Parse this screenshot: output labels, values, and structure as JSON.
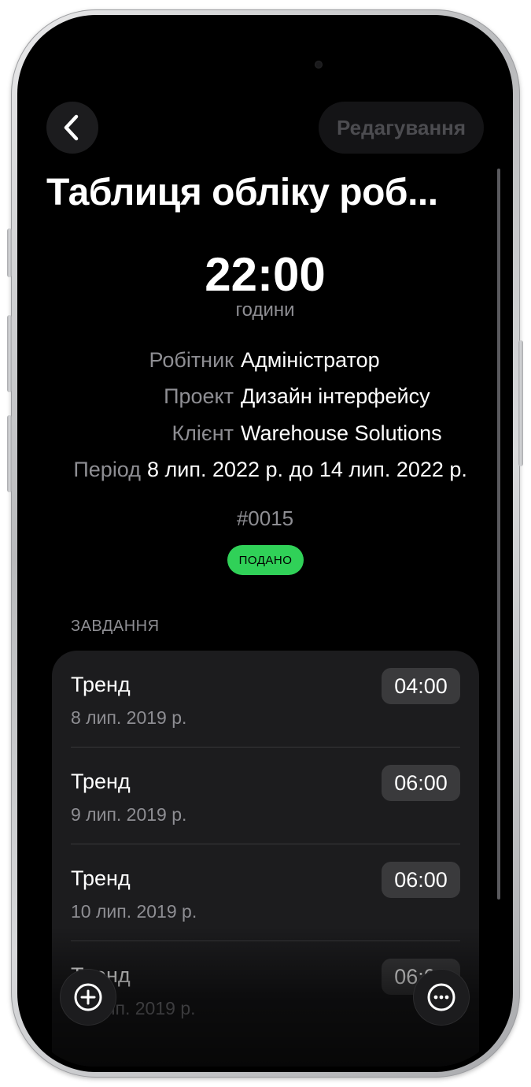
{
  "nav": {
    "back_icon": "chevron-left-icon",
    "edit_label": "Редагування"
  },
  "title": "Таблиця обліку роб...",
  "total": {
    "hours_value": "22:00",
    "hours_label": "години"
  },
  "info": {
    "worker_label": "Робітник",
    "worker_value": "Адміністратор",
    "project_label": "Проект",
    "project_value": "Дизайн інтерфейсу",
    "client_label": "Клієнт",
    "client_value": "Warehouse Solutions",
    "period_label": "Період",
    "period_value": "8 лип. 2022 р. до 14 лип. 2022 р."
  },
  "number": "#0015",
  "status": {
    "label": "ПОДАНО",
    "color": "#30d158"
  },
  "tasks_header": "ЗАВДАННЯ",
  "tasks": [
    {
      "name": "Тренд",
      "date": "8 лип. 2019 р.",
      "hours": "04:00"
    },
    {
      "name": "Тренд",
      "date": "9 лип. 2019 р.",
      "hours": "06:00"
    },
    {
      "name": "Тренд",
      "date": "10 лип. 2019 р.",
      "hours": "06:00"
    },
    {
      "name": "Тренд",
      "date": "11 лип. 2019 р.",
      "hours": "06:00"
    }
  ],
  "fab": {
    "add_icon": "plus-circle-icon",
    "more_icon": "ellipsis-circle-icon"
  }
}
